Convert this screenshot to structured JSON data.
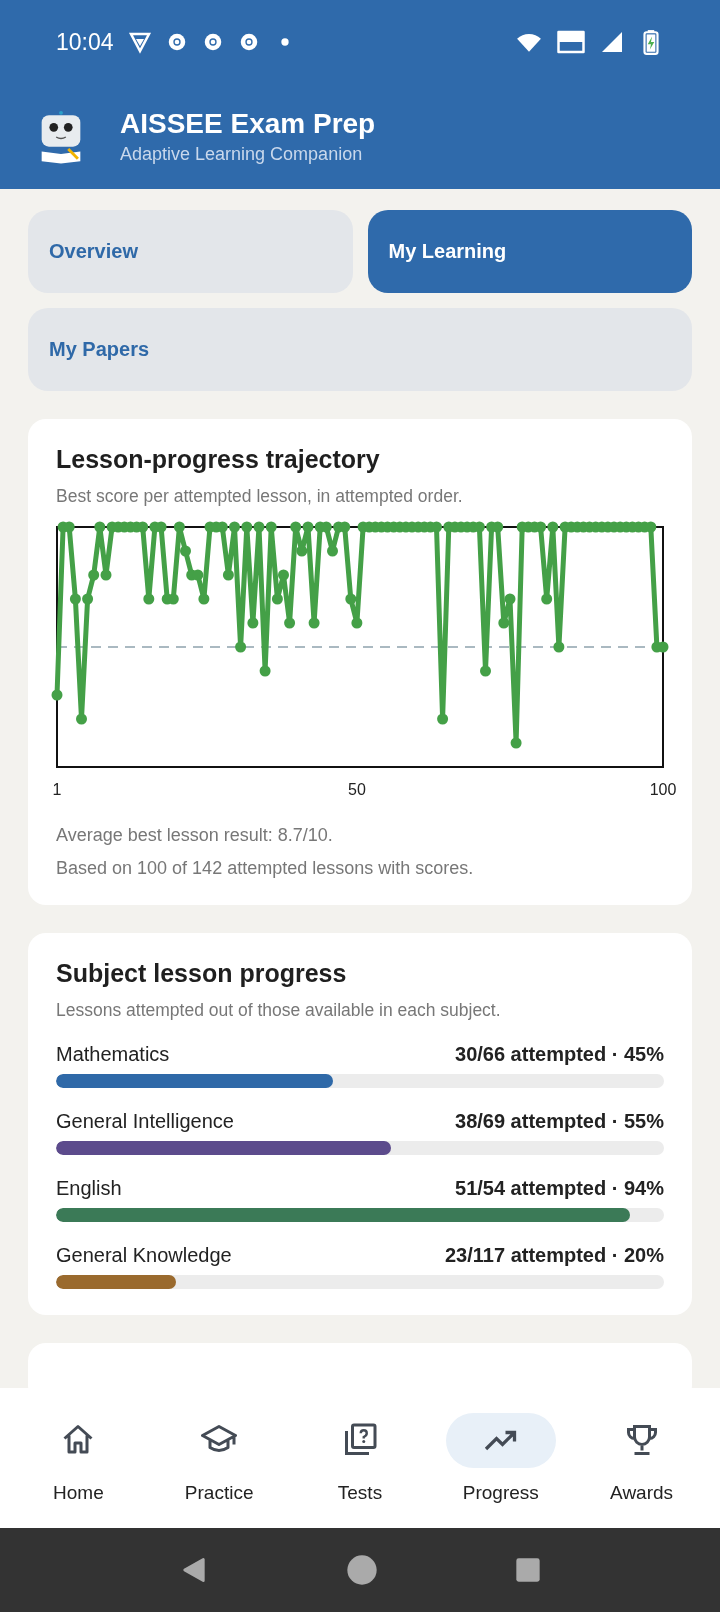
{
  "status_bar": {
    "time": "10:04"
  },
  "app_bar": {
    "title": "AISSEE Exam Prep",
    "subtitle": "Adaptive Learning Companion"
  },
  "tabs": [
    {
      "label": "Overview",
      "selected": false
    },
    {
      "label": "My Learning",
      "selected": true
    },
    {
      "label": "My Papers",
      "selected": false
    }
  ],
  "trajectory_card": {
    "title": "Lesson-progress trajectory",
    "subtitle": "Best score per attempted lesson, in attempted order.",
    "x_tick_labels": [
      "1",
      "50",
      "100"
    ],
    "notes": [
      "Average best lesson result: 8.7/10.",
      "Based on 100 of 142 attempted lessons with scores."
    ]
  },
  "subject_progress_card": {
    "title": "Subject lesson progress",
    "subtitle": "Lessons attempted out of those available in each subject.",
    "subjects": [
      {
        "name": "Mathematics",
        "reading": "30/66 attempted · 45%",
        "level": 0.455,
        "color": "#2f69a8"
      },
      {
        "name": "General Intelligence",
        "reading": "38/69 attempted · 55%",
        "level": 0.551,
        "color": "#5c4b8c"
      },
      {
        "name": "English",
        "reading": "51/54 attempted · 94%",
        "level": 0.944,
        "color": "#3b7a57"
      },
      {
        "name": "General Knowledge",
        "reading": "23/117 attempted · 20%",
        "level": 0.197,
        "color": "#9a6a2e"
      }
    ]
  },
  "bottom_nav": [
    {
      "label": "Home",
      "selected": false
    },
    {
      "label": "Practice",
      "selected": false
    },
    {
      "label": "Tests",
      "selected": false
    },
    {
      "label": "Progress",
      "selected": true
    },
    {
      "label": "Awards",
      "selected": false
    }
  ]
}
